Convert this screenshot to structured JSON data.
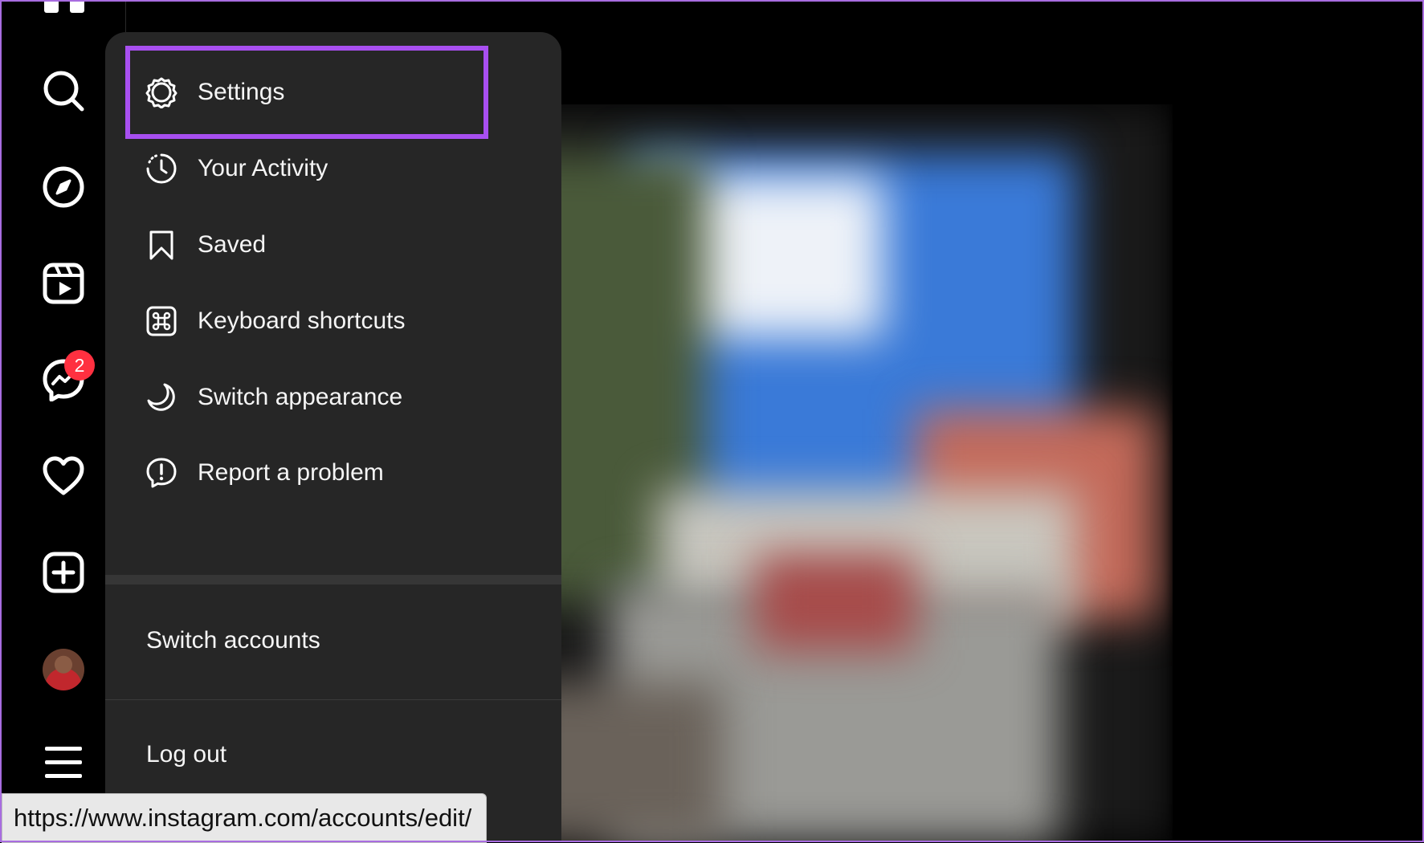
{
  "sidebar": {
    "icons": [
      "search-icon",
      "explore-icon",
      "reels-icon",
      "messenger-icon",
      "heart-icon",
      "create-icon",
      "avatar",
      "menu-icon"
    ],
    "messages_badge": "2"
  },
  "menu": {
    "items": [
      {
        "label": "Settings",
        "icon": "gear-icon"
      },
      {
        "label": "Your Activity",
        "icon": "activity-icon"
      },
      {
        "label": "Saved",
        "icon": "bookmark-icon"
      },
      {
        "label": "Keyboard shortcuts",
        "icon": "command-icon"
      },
      {
        "label": "Switch appearance",
        "icon": "moon-icon"
      },
      {
        "label": "Report a problem",
        "icon": "report-icon"
      }
    ],
    "switch_accounts": "Switch accounts",
    "log_out": "Log out"
  },
  "status_url": "https://www.instagram.com/accounts/edit/",
  "colors": {
    "highlight": "#a84ff0",
    "menu_bg": "#262626",
    "badge": "#ff3040"
  }
}
